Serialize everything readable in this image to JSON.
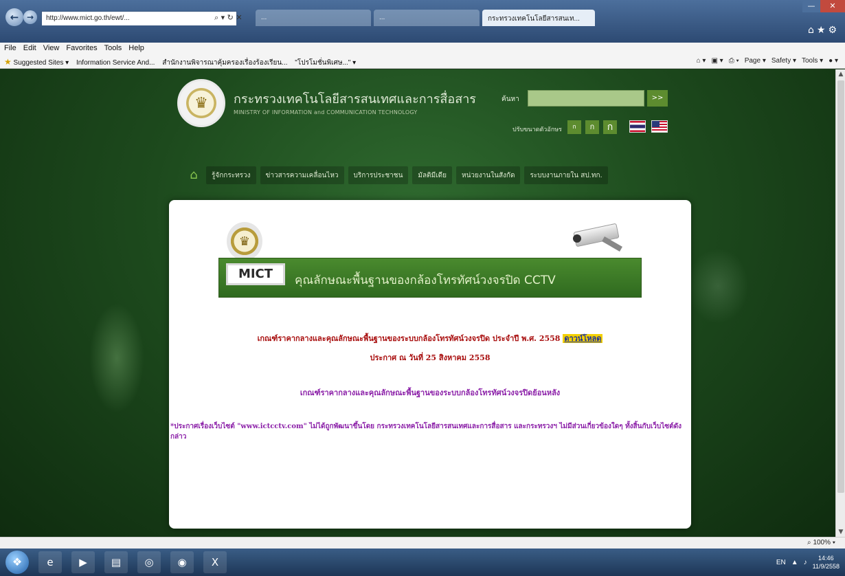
{
  "browser": {
    "address": "http://www.mict.go.th/ewt/...",
    "address_strong": "mict.go.th",
    "tabs": [
      "...",
      "...",
      "กระทรวงเทคโนโลยีสารสนเท..."
    ],
    "menu": [
      "File",
      "Edit",
      "View",
      "Favorites",
      "Tools",
      "Help"
    ],
    "favorites": [
      "Suggested Sites ▾",
      "Information Service And...",
      "สำนักงานพิจารณาคุ้มครองเรื่องร้องเรียน...",
      "\"โปรโมชั่นพิเศษ...\" ▾"
    ],
    "commands": [
      "Page ▾",
      "Safety ▾",
      "Tools ▾"
    ],
    "zoom": "100%"
  },
  "site": {
    "title": "กระทรวงเทคโนโลยีสารสนเทศและการสื่อสาร",
    "subtitle": "MINISTRY OF INFORMATION and COMMUNICATION TECHNOLOGY",
    "search_label": "ค้นหา",
    "search_button": ">>",
    "font_size_label": "ปรับขนาดตัวอักษร",
    "font_sizes": [
      "ก",
      "ก",
      "ก"
    ],
    "nav": [
      "รู้จักกระทรวง",
      "ข่าวสารความเคลื่อนไหว",
      "บริการประชาชน",
      "มัลติมีเดีย",
      "หน่วยงานในสังกัด",
      "ระบบงานภายใน สป.ทก."
    ]
  },
  "content": {
    "mict_label": "MICT",
    "banner_text": "คุณลักษณะพื้นฐานของกล้องโทรทัศน์วงจรปิด CCTV",
    "line1": "เกณฑ์ราคากลางและคุณลักษณะพื้นฐานของระบบกล้องโทรทัศน์วงจรปิด ประจำปี พ.ศ. 2558",
    "line1_link": "ดาวน์โหลด",
    "line2": "ประกาศ ณ วันที่ 25 สิงหาคม 2558",
    "line3": "เกณฑ์ราคากลางและคุณลักษณะพื้นฐานของระบบกล้องโทรทัศน์วงจรปิดย้อนหลัง",
    "note": "*ประกาศเรื่องเว็บไซต์ \"www.ictcctv.com\" ไม่ได้ถูกพัฒนาขึ้นโดย กระทรวงเทคโนโลยีสารสนเทศและการสื่อสาร และกระทรวงฯ ไม่มีส่วนเกี่ยวข้องใดๆ ทั้งสิ้นกับเว็บไซต์ดังกล่าว"
  },
  "taskbar": {
    "time": "14:46",
    "date": "11/9/2558",
    "lang": "EN"
  }
}
